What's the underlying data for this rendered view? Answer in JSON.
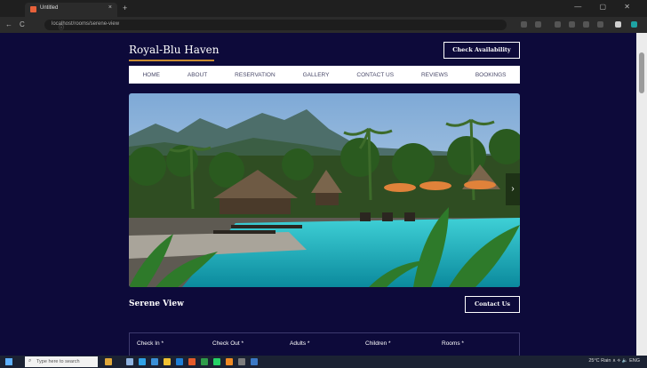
{
  "browser": {
    "tab_title": "Untitled",
    "tab_close": "×",
    "new_tab": "+",
    "window_controls": "— ▢ ✕",
    "back": "←",
    "reload": "C",
    "info": "ⓘ",
    "url": "localhost/rooms/serene-view"
  },
  "site": {
    "brand": "Royal-Blu Haven",
    "check_availability": "Check Availability",
    "nav": [
      "HOME",
      "ABOUT",
      "RESERVATION",
      "GALLERY",
      "CONTACT US",
      "REVIEWS",
      "BOOKINGS"
    ],
    "hero_next": "›",
    "room_title": "Serene View",
    "contact_button": "Contact Us",
    "booking_fields": [
      "Check In *",
      "Check Out *",
      "Adults *",
      "Children *",
      "Rooms *"
    ]
  },
  "taskbar": {
    "search_placeholder": "Type here to search",
    "search_icon": "⌕",
    "tray_text": "25°C Rain  ∧  ⟡ 🔈 ENG"
  },
  "colors": {
    "page_bg": "#0d0a3a",
    "accent": "#c68a2f",
    "water": "#1ab4c8"
  }
}
